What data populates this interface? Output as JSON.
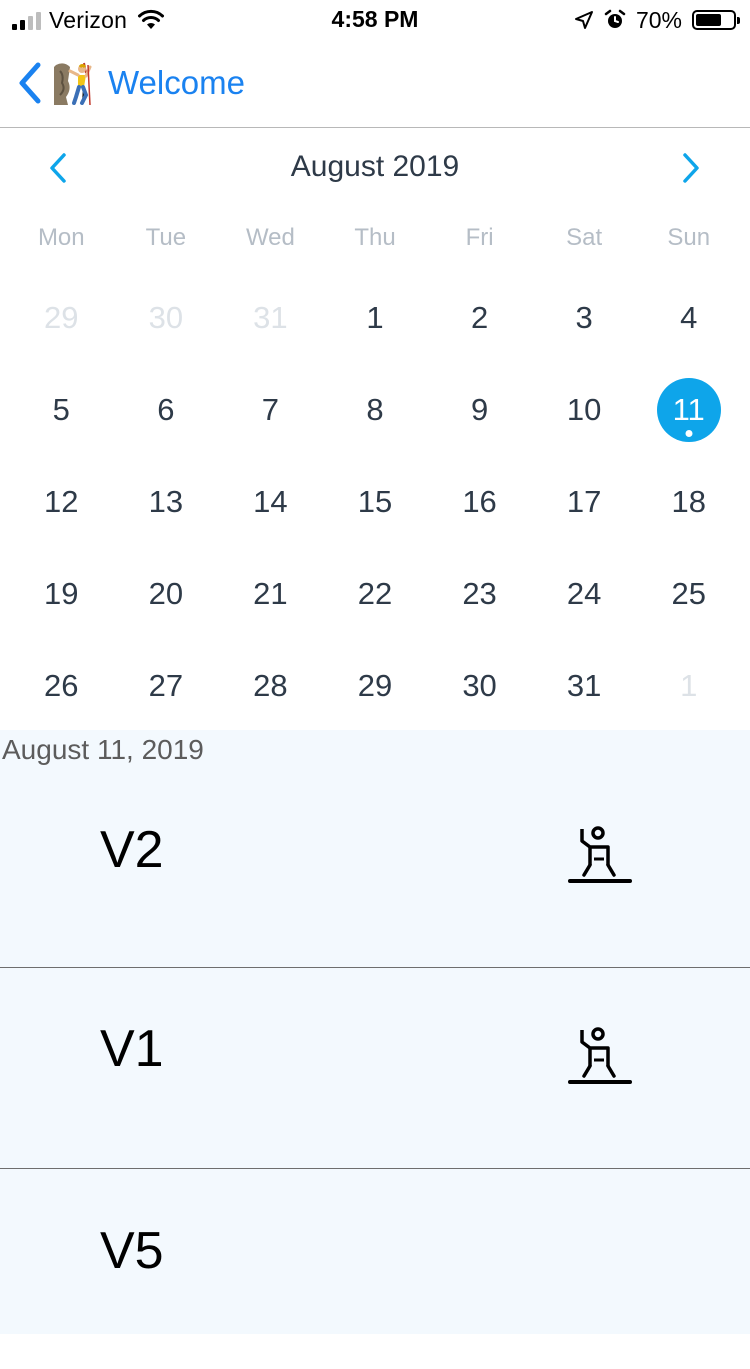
{
  "status_bar": {
    "carrier": "Verizon",
    "time": "4:58 PM",
    "battery_percent": "70%",
    "battery_level": 0.7,
    "icons": [
      "signal-icon",
      "wifi-icon",
      "location-arrow-icon",
      "alarm-icon",
      "battery-icon"
    ]
  },
  "nav": {
    "back_label": "Welcome",
    "back_icon": "chevron-left-icon",
    "emoji_icon": "person-climbing-icon",
    "accent_color": "#1a82f0"
  },
  "calendar": {
    "month_title": "August 2019",
    "weekdays": [
      "Mon",
      "Tue",
      "Wed",
      "Thu",
      "Fri",
      "Sat",
      "Sun"
    ],
    "days": [
      {
        "n": "29",
        "current": false
      },
      {
        "n": "30",
        "current": false
      },
      {
        "n": "31",
        "current": false
      },
      {
        "n": "1",
        "current": true
      },
      {
        "n": "2",
        "current": true
      },
      {
        "n": "3",
        "current": true
      },
      {
        "n": "4",
        "current": true
      },
      {
        "n": "5",
        "current": true
      },
      {
        "n": "6",
        "current": true
      },
      {
        "n": "7",
        "current": true
      },
      {
        "n": "8",
        "current": true
      },
      {
        "n": "9",
        "current": true
      },
      {
        "n": "10",
        "current": true
      },
      {
        "n": "11",
        "current": true,
        "selected": true,
        "has_event": true
      },
      {
        "n": "12",
        "current": true
      },
      {
        "n": "13",
        "current": true
      },
      {
        "n": "14",
        "current": true
      },
      {
        "n": "15",
        "current": true
      },
      {
        "n": "16",
        "current": true
      },
      {
        "n": "17",
        "current": true
      },
      {
        "n": "18",
        "current": true
      },
      {
        "n": "19",
        "current": true
      },
      {
        "n": "20",
        "current": true
      },
      {
        "n": "21",
        "current": true
      },
      {
        "n": "22",
        "current": true
      },
      {
        "n": "23",
        "current": true
      },
      {
        "n": "24",
        "current": true
      },
      {
        "n": "25",
        "current": true
      },
      {
        "n": "26",
        "current": true
      },
      {
        "n": "27",
        "current": true
      },
      {
        "n": "28",
        "current": true
      },
      {
        "n": "29",
        "current": true
      },
      {
        "n": "30",
        "current": true
      },
      {
        "n": "31",
        "current": true
      },
      {
        "n": "1",
        "current": false
      }
    ],
    "selected_color": "#0ea5ea"
  },
  "events": {
    "date_label": "August 11, 2019",
    "items": [
      {
        "grade": "V2",
        "icon": "boulder-climber-icon",
        "has_icon": true
      },
      {
        "grade": "V1",
        "icon": "boulder-climber-icon",
        "has_icon": true
      },
      {
        "grade": "V5",
        "has_icon": false
      }
    ],
    "background_color": "#f3f9fe"
  }
}
